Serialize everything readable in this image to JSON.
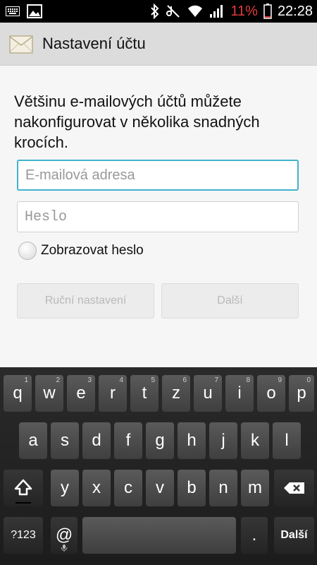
{
  "status_bar": {
    "battery_percent": "11%",
    "time": "22:28"
  },
  "action_bar": {
    "title": "Nastavení účtu"
  },
  "content": {
    "intro": "Většinu e-mailových účtů můžete nakonfigurovat v několika snadných krocích.",
    "email_placeholder": "E-mailová adresa",
    "password_placeholder": "Heslo",
    "show_password_label": "Zobrazovat heslo",
    "manual_setup_label": "Ruční nastavení",
    "next_label": "Další"
  },
  "keyboard": {
    "row1": [
      {
        "key": "q",
        "hint": "1"
      },
      {
        "key": "w",
        "hint": "2"
      },
      {
        "key": "e",
        "hint": "3"
      },
      {
        "key": "r",
        "hint": "4"
      },
      {
        "key": "t",
        "hint": "5"
      },
      {
        "key": "z",
        "hint": "6"
      },
      {
        "key": "u",
        "hint": "7"
      },
      {
        "key": "i",
        "hint": "8"
      },
      {
        "key": "o",
        "hint": "9"
      },
      {
        "key": "p",
        "hint": "0"
      }
    ],
    "row2": [
      "a",
      "s",
      "d",
      "f",
      "g",
      "h",
      "j",
      "k",
      "l"
    ],
    "row3": [
      "y",
      "x",
      "c",
      "v",
      "b",
      "n",
      "m"
    ],
    "symbols_label": "?123",
    "at_label": "@",
    "period_label": ".",
    "enter_label": "Další",
    "icons": {
      "shift": "shift-icon",
      "backspace": "backspace-icon",
      "mic": "microphone-icon"
    }
  }
}
